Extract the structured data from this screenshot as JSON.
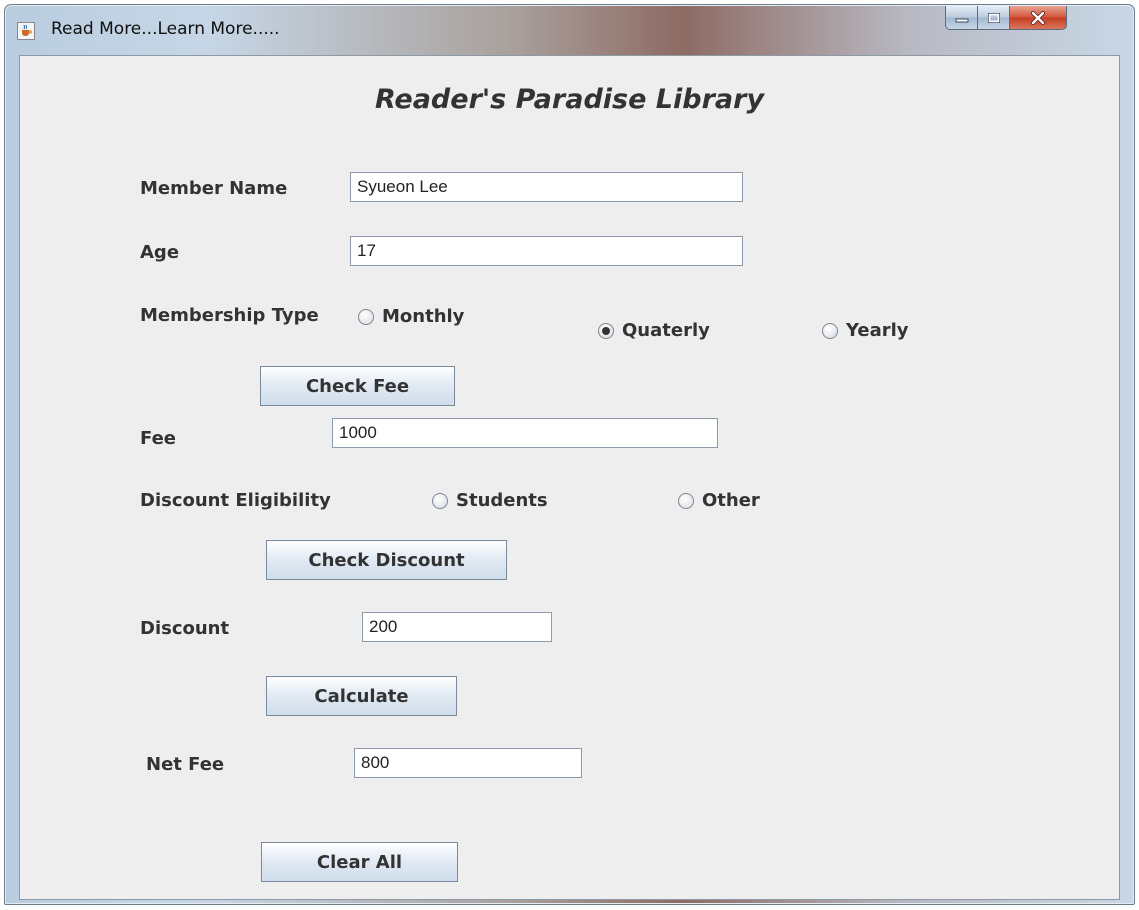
{
  "window": {
    "title": "Read More...Learn More....."
  },
  "form": {
    "heading": "Reader's Paradise Library",
    "member_name": {
      "label": "Member Name",
      "value": "Syueon Lee"
    },
    "age": {
      "label": "Age",
      "value": "17"
    },
    "membership_type": {
      "label": "Membership Type",
      "options": [
        {
          "label": "Monthly",
          "selected": false
        },
        {
          "label": "Quaterly",
          "selected": true
        },
        {
          "label": "Yearly",
          "selected": false
        }
      ]
    },
    "check_fee_button": "Check Fee",
    "fee": {
      "label": "Fee",
      "value": "1000"
    },
    "discount_eligibility": {
      "label": "Discount Eligibility",
      "options": [
        {
          "label": "Students",
          "selected": false
        },
        {
          "label": "Other",
          "selected": false
        }
      ]
    },
    "check_discount_button": "Check Discount",
    "discount": {
      "label": "Discount",
      "value": "200"
    },
    "calculate_button": "Calculate",
    "net_fee": {
      "label": "Net Fee",
      "value": "800"
    },
    "clear_all_button": "Clear All"
  }
}
